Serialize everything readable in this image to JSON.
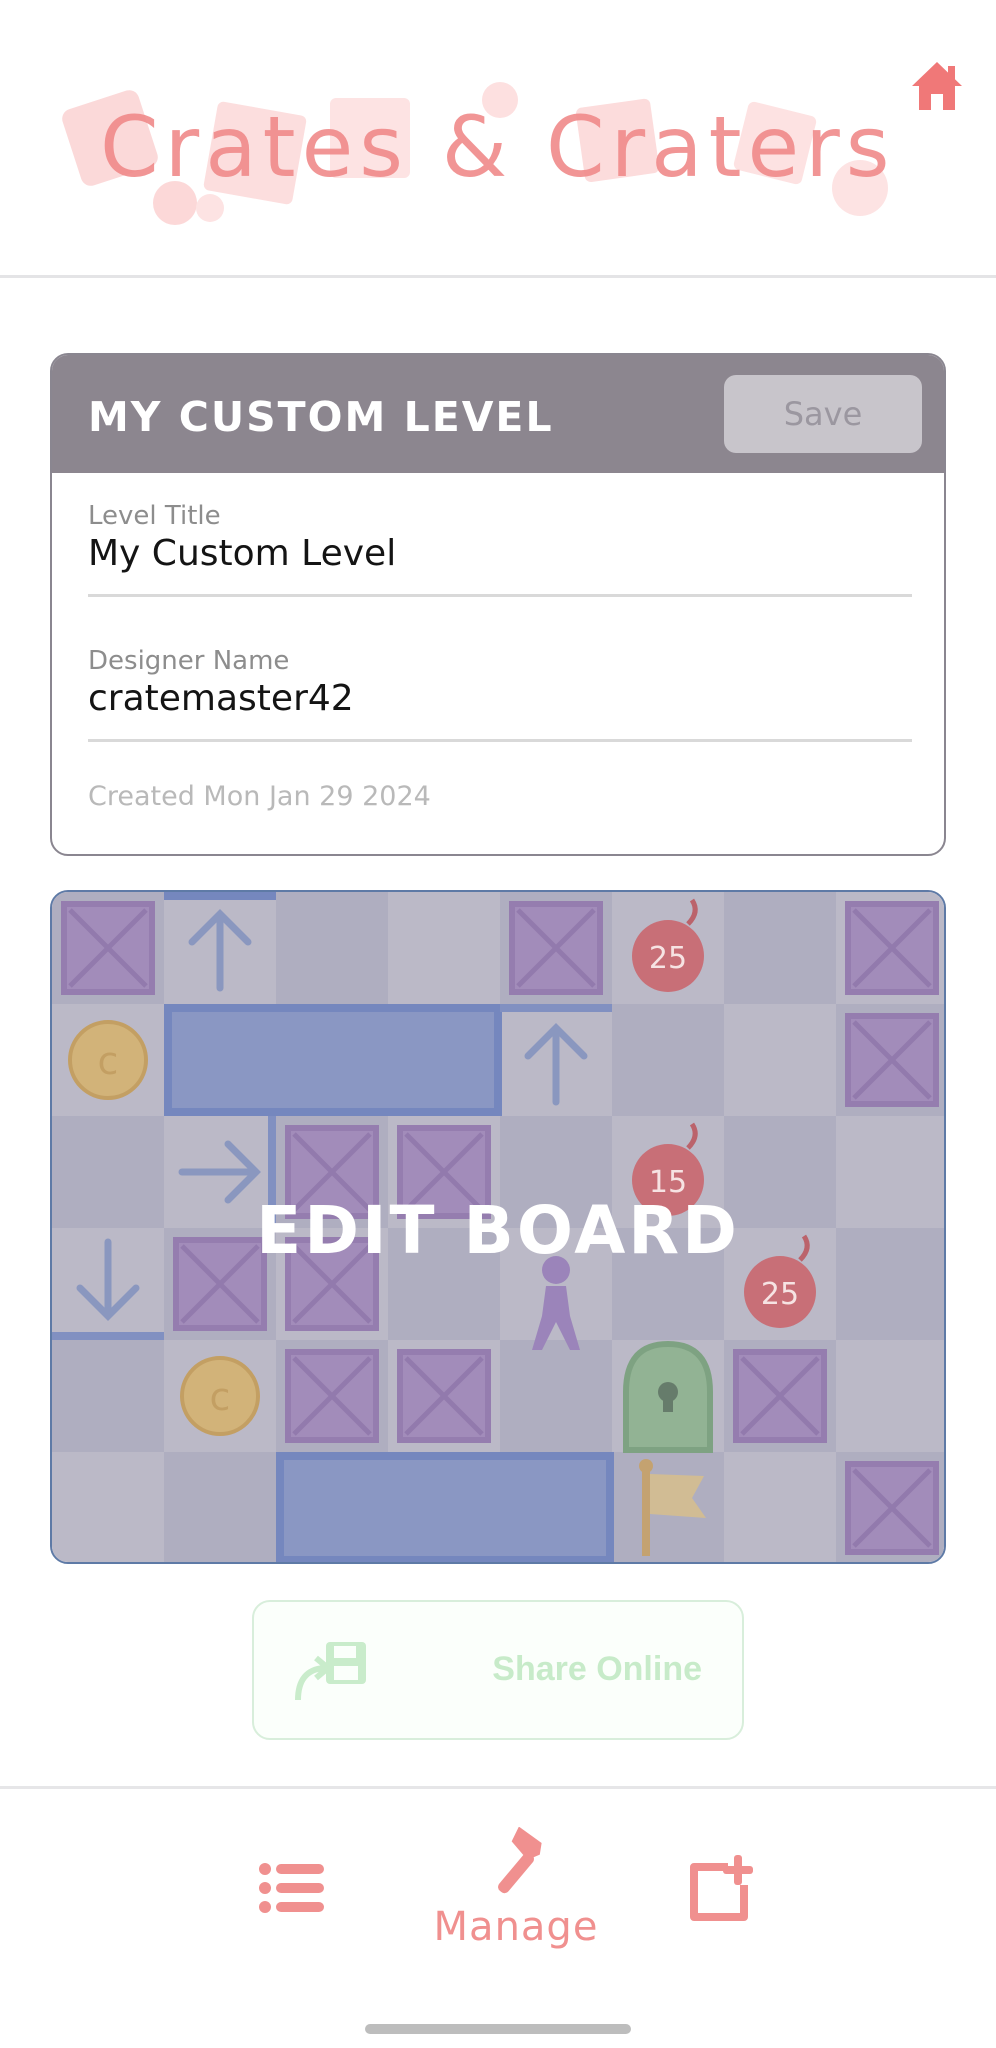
{
  "header": {
    "logo_text": "Crates & Craters",
    "home_icon": "home-icon"
  },
  "card": {
    "title": "MY CUSTOM LEVEL",
    "save_label": "Save",
    "fields": [
      {
        "label": "Level Title",
        "value": "My Custom Level"
      },
      {
        "label": "Designer Name",
        "value": "cratemaster42"
      }
    ],
    "created": "Created Mon Jan 29 2024"
  },
  "board": {
    "overlay_label": "EDIT BOARD",
    "bombs": [
      "25",
      "15",
      "25"
    ]
  },
  "share": {
    "label": "Share Online",
    "icon": "save-floppy-icon"
  },
  "bottom_nav": {
    "items": [
      {
        "icon": "list-icon",
        "label": ""
      },
      {
        "icon": "hammer-icon",
        "label": "Manage"
      },
      {
        "icon": "new-level-icon",
        "label": ""
      }
    ]
  },
  "colors": {
    "accent": "#f08a8a",
    "card_header": "#8c868f",
    "board_border": "#5e7aa6",
    "share_text": "#c7ebc9"
  }
}
